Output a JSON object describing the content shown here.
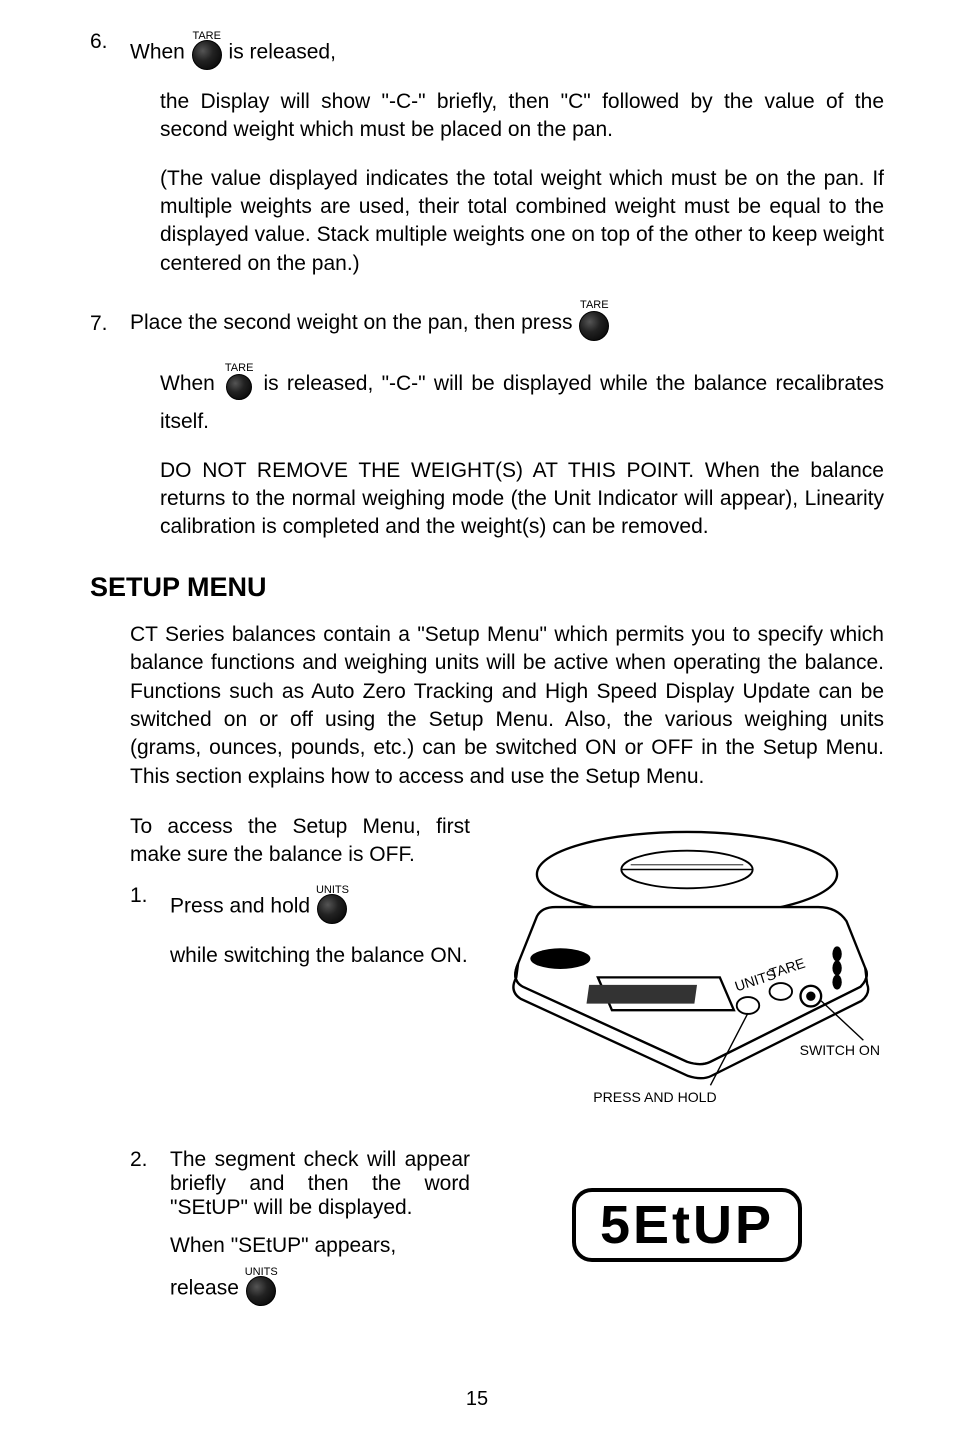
{
  "step6": {
    "num": "6.",
    "text_before": "When",
    "button_label": "TARE",
    "text_after": "is released,",
    "para1": "the Display will show \"-C-\" briefly, then \"C\" followed by the value of the second weight which must be placed on the pan.",
    "para2": "(The value displayed indicates the total weight which must be on the pan. If multiple weights are used, their total combined weight must be equal to the displayed value. Stack multiple weights one on top of the other to keep weight centered on the pan.)"
  },
  "step7": {
    "num": "7.",
    "line1_before": "Place the second weight on the pan, then press",
    "button1_label": "TARE",
    "line2_before": "When",
    "button2_label": "TARE",
    "line2_after": "is released, \"-C-\" will be displayed while the balance recalibrates itself.",
    "para3": "DO NOT REMOVE THE WEIGHT(S) AT THIS POINT. When the balance returns to the normal weighing mode (the Unit Indicator will appear), Linearity calibration is completed and the weight(s) can be removed."
  },
  "heading": "SETUP MENU",
  "intro": "CT Series balances contain a \"Setup Menu\" which permits you to specify which balance functions and weighing units will be active when operating the balance. Functions such as Auto Zero Tracking and High Speed Display Update can be switched on or off using the Setup Menu. Also, the various weighing units (grams, ounces, pounds, etc.) can be switched ON or OFF in the Setup Menu. This section explains how to access and use the Setup Menu.",
  "access": "To access the Setup Menu, first make sure the balance is OFF.",
  "setup1": {
    "num": "1.",
    "text_before": "Press and hold",
    "button_label": "UNITS",
    "line2": "while switching the balance ON."
  },
  "diagram": {
    "press_hold": "PRESS AND HOLD",
    "switch_on": "SWITCH ON",
    "units_label": "UNITS",
    "tare_label": "TARE"
  },
  "setup2": {
    "num": "2.",
    "para": "The segment check will appear briefly and then the word \"SEtUP\" will be displayed.",
    "line2": "When \"SEtUP\" appears,",
    "release": "release",
    "button_label": "UNITS"
  },
  "display_text": "5EtUP",
  "page_num": "15"
}
